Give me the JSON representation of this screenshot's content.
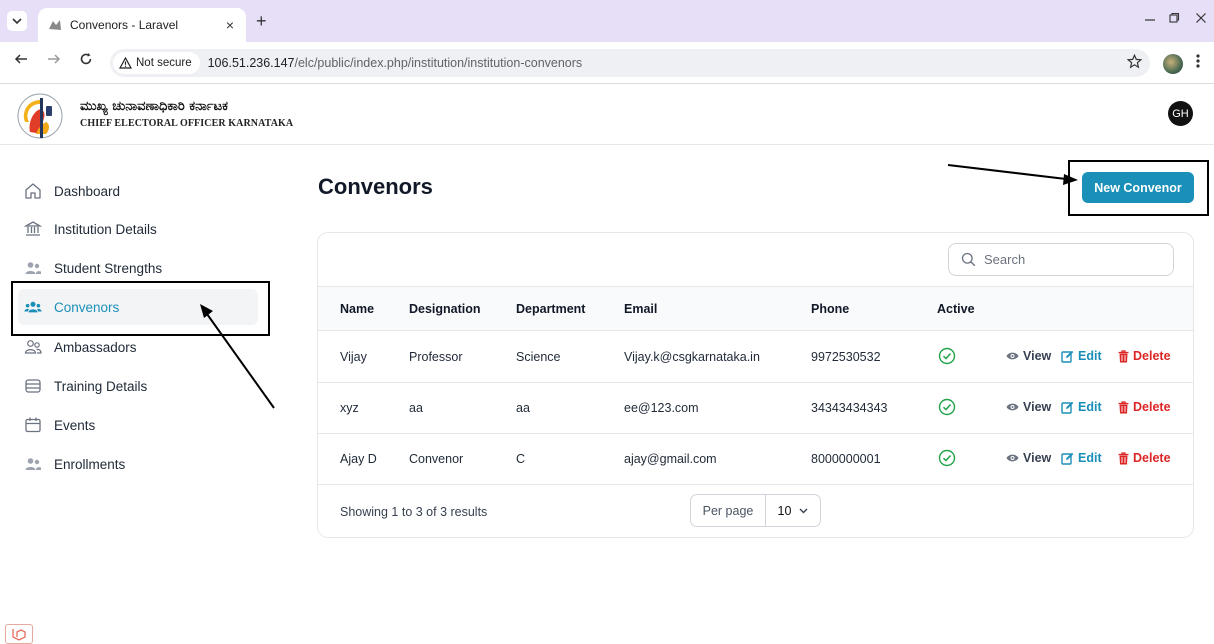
{
  "browser": {
    "tab_title": "Convenors - Laravel",
    "tab_close": "×",
    "new_tab": "+",
    "not_secure_label": "Not secure",
    "url_host": "106.51.236.147",
    "url_path": "/elc/public/index.php/institution/institution-convenors",
    "icons": [
      "tab-search-icon",
      "laravel-favicon-icon",
      "back-icon",
      "forward-icon",
      "reload-icon",
      "warning-icon",
      "star-icon",
      "profile-icon",
      "kebab-menu-icon",
      "minimize-icon",
      "restore-icon",
      "close-icon"
    ]
  },
  "header": {
    "brand_kannada": "ಮುಖ್ಯ ಚುನಾವಣಾಧಿಕಾರಿ ಕರ್ನಾಟಕ",
    "brand_english": "CHIEF ELECTORAL OFFICER KARNATAKA",
    "avatar_initials": "GH"
  },
  "sidebar": {
    "items": [
      {
        "label": "Dashboard",
        "icon": "home-icon"
      },
      {
        "label": "Institution Details",
        "icon": "bank-icon"
      },
      {
        "label": "Student Strengths",
        "icon": "users-icon"
      },
      {
        "label": "Convenors",
        "icon": "user-group-icon",
        "active": true
      },
      {
        "label": "Ambassadors",
        "icon": "user-outline-group-icon"
      },
      {
        "label": "Training Details",
        "icon": "stack-icon"
      },
      {
        "label": "Events",
        "icon": "calendar-icon"
      },
      {
        "label": "Enrollments",
        "icon": "users-icon"
      }
    ]
  },
  "main": {
    "title": "Convenors",
    "new_button": "New Convenor",
    "search_placeholder": "Search",
    "columns": [
      "Name",
      "Designation",
      "Department",
      "Email",
      "Phone",
      "Active"
    ],
    "rows": [
      {
        "name": "Vijay",
        "designation": "Professor",
        "department": "Science",
        "email": "Vijay.k@csgkarnataka.in",
        "phone": "9972530532",
        "active": true
      },
      {
        "name": "xyz",
        "designation": "aa",
        "department": "aa",
        "email": "ee@123.com",
        "phone": "34343434343",
        "active": true
      },
      {
        "name": "Ajay D",
        "designation": "Convenor",
        "department": "C",
        "email": "ajay@gmail.com",
        "phone": "8000000001",
        "active": true
      }
    ],
    "actions": {
      "view": "View",
      "edit": "Edit",
      "delete": "Delete"
    },
    "footer_text": "Showing 1 to 3 of 3 results",
    "per_page_label": "Per page",
    "per_page_value": "10"
  },
  "colors": {
    "accent": "#1a8fb8",
    "danger": "#dc2626",
    "success": "#22a34a",
    "tabbar": "#e6dff7"
  }
}
